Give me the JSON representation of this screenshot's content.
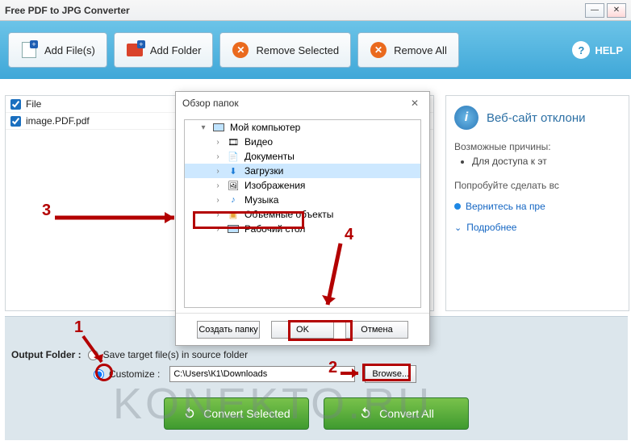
{
  "window": {
    "title": "Free PDF to JPG Converter"
  },
  "toolbar": {
    "add_file": "Add File(s)",
    "add_folder": "Add Folder",
    "remove_selected": "Remove Selected",
    "remove_all": "Remove All",
    "help": "HELP"
  },
  "files": {
    "header": "File",
    "items": [
      "image.PDF.pdf"
    ]
  },
  "info": {
    "title": "Веб-сайт отклони",
    "reasons_label": "Возможные причины:",
    "reason1": "Для доступа к эт",
    "try_label": "Попробуйте сделать вс",
    "try1": "Вернитесь на пре",
    "more": "Подробнее"
  },
  "output": {
    "label": "Output Folder :",
    "save_source": "Save target file(s) in source folder",
    "customize": "Customize :",
    "path": "C:\\Users\\К1\\Downloads",
    "browse": "Browse...",
    "convert_selected": "Convert Selected",
    "convert_all": "Convert All"
  },
  "dialog": {
    "title": "Обзор папок",
    "root": "Мой компьютер",
    "nodes": [
      "Видео",
      "Документы",
      "Загрузки",
      "Изображения",
      "Музыка",
      "Объемные объекты",
      "Рабочий стол"
    ],
    "create": "Создать папку",
    "ok": "OK",
    "cancel": "Отмена"
  },
  "annotations": {
    "n1": "1",
    "n2": "2",
    "n3": "3",
    "n4": "4"
  },
  "watermark": "KONEKTO.RU"
}
